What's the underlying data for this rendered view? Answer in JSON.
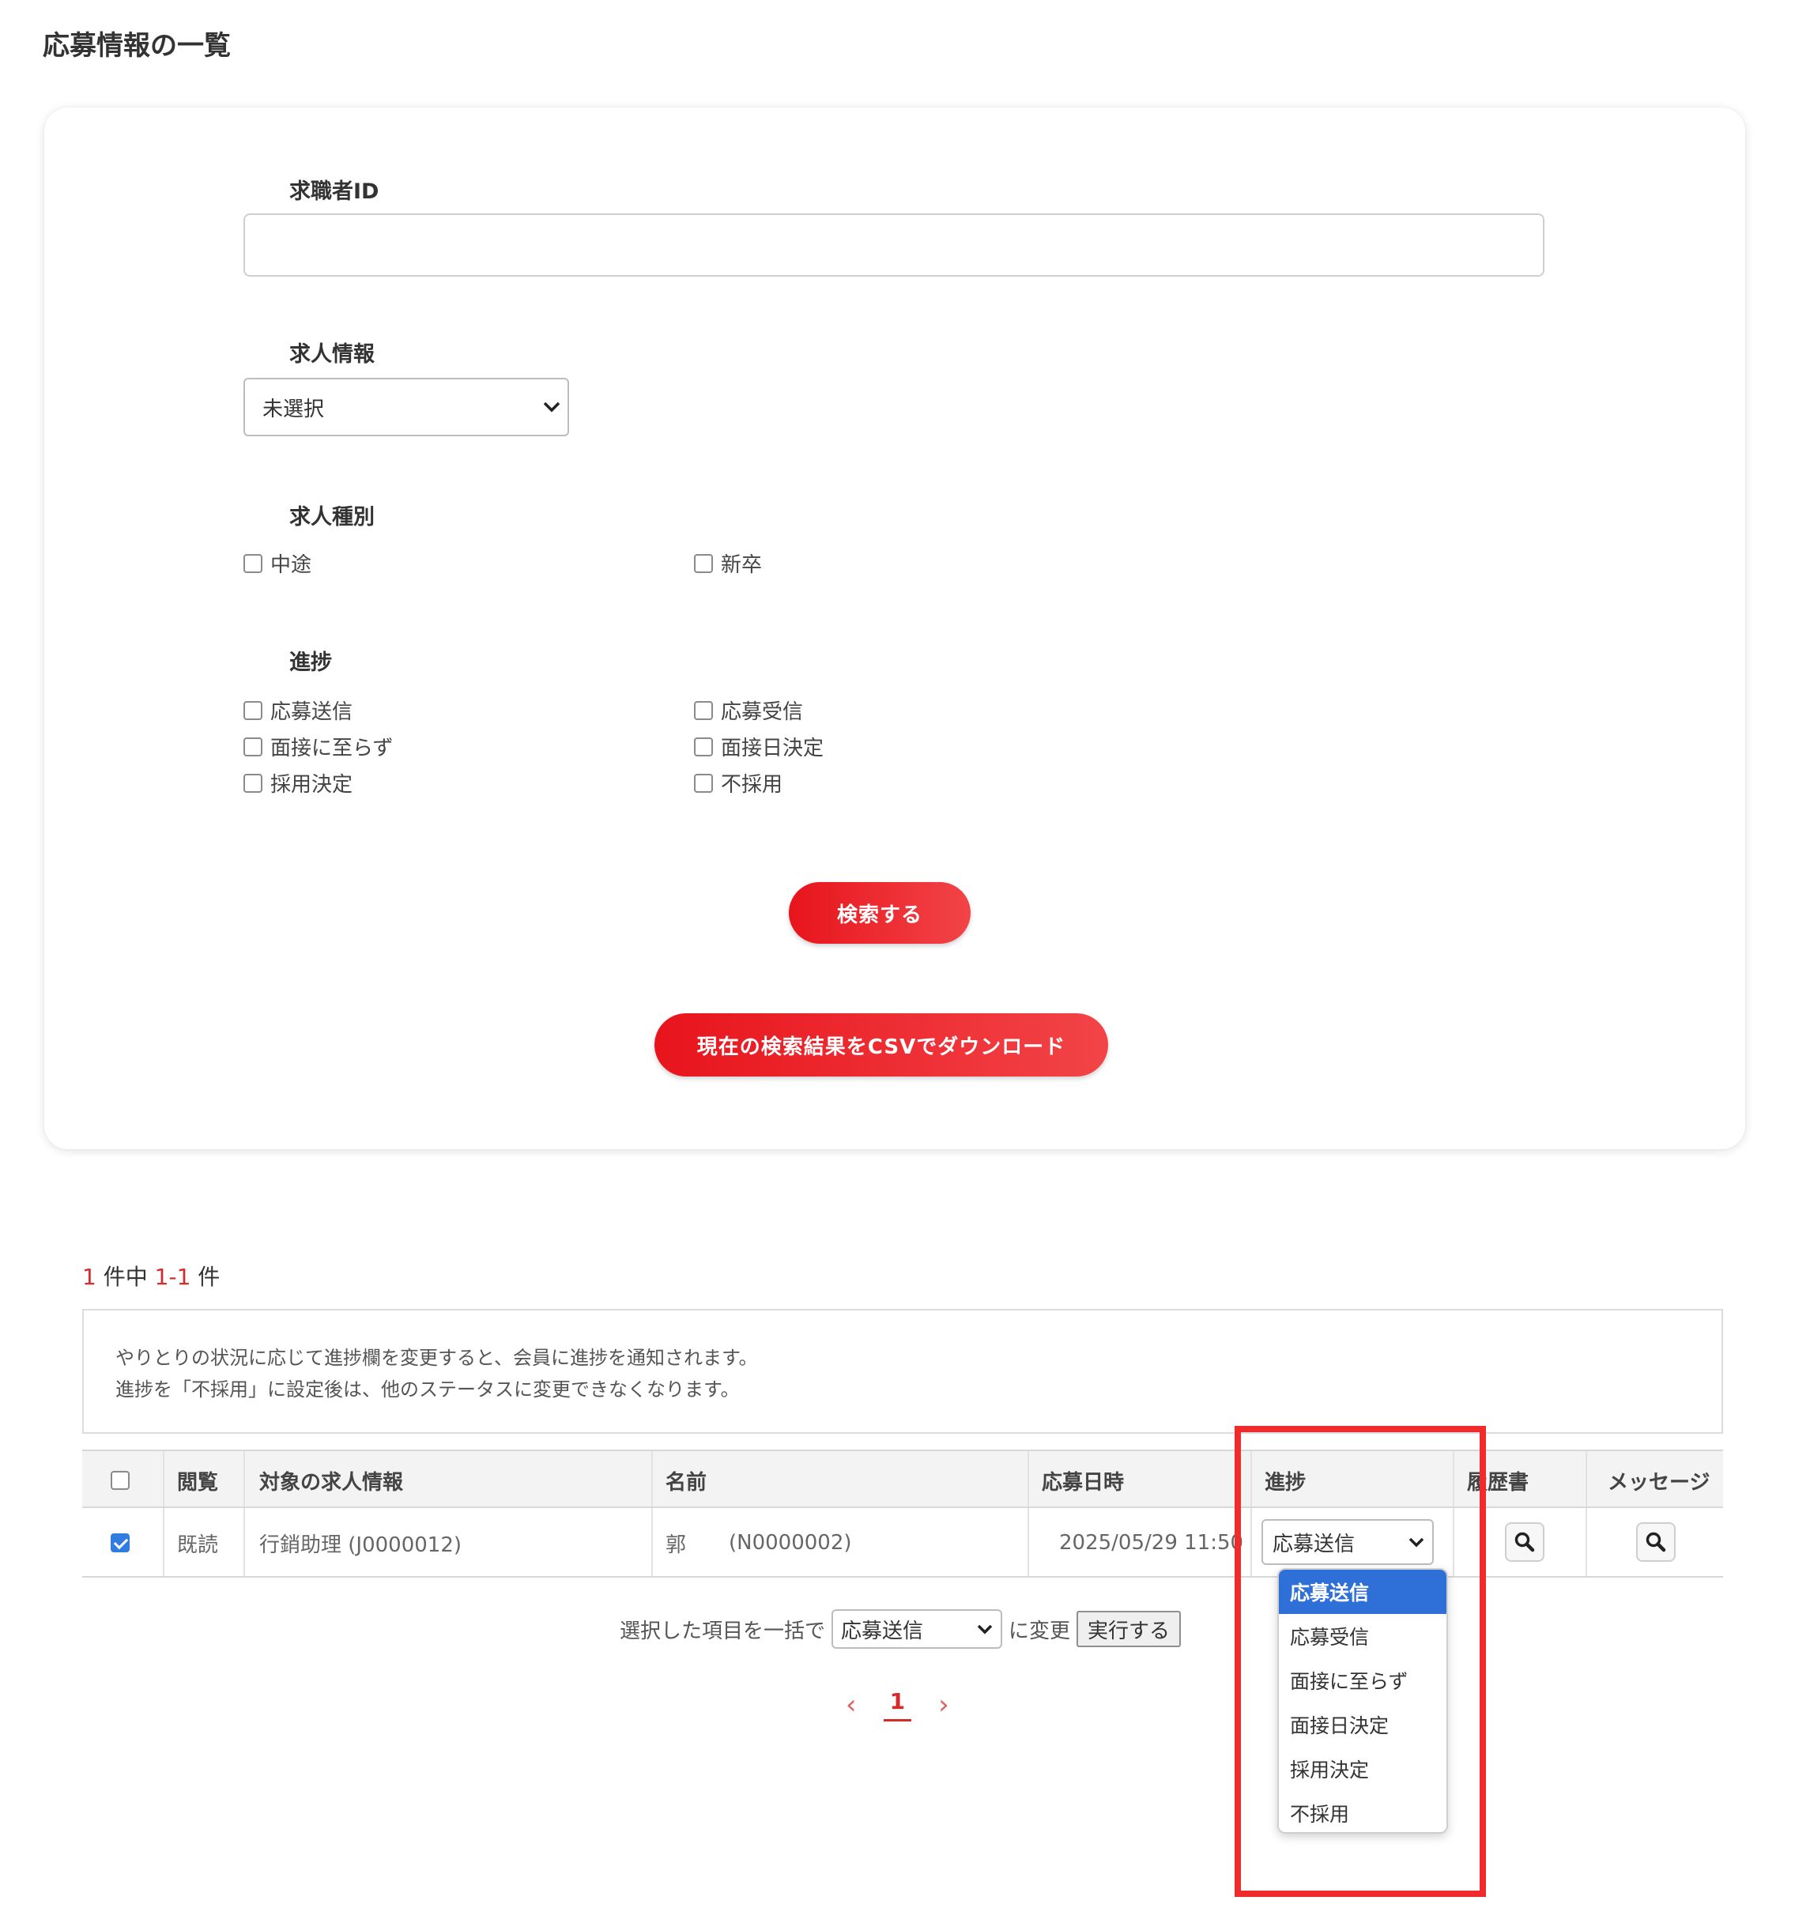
{
  "page": {
    "title": "応募情報の一覧"
  },
  "search": {
    "seeker_id_label": "求職者ID",
    "seeker_id_value": "",
    "job_info_label": "求人情報",
    "job_info_selected": "未選択",
    "job_type_label": "求人種別",
    "job_types": [
      {
        "label": "中途",
        "checked": false
      },
      {
        "label": "新卒",
        "checked": false
      }
    ],
    "progress_label": "進捗",
    "progress_options": [
      {
        "label": "応募送信",
        "checked": false
      },
      {
        "label": "応募受信",
        "checked": false
      },
      {
        "label": "面接に至らず",
        "checked": false
      },
      {
        "label": "面接日決定",
        "checked": false
      },
      {
        "label": "採用決定",
        "checked": false
      },
      {
        "label": "不採用",
        "checked": false
      }
    ],
    "search_button": "検索する",
    "csv_button": "現在の検索結果をCSVでダウンロード"
  },
  "results": {
    "total": "1",
    "total_suffix": "件中",
    "range": "1-1",
    "range_suffix": "件"
  },
  "notice": {
    "line1": "やりとりの状況に応じて進捗欄を変更すると、会員に進捗を通知されます。",
    "line2": "進捗を「不採用」に設定後は、他のステータスに変更できなくなります。"
  },
  "table": {
    "headers": {
      "view": "閲覧",
      "job": "対象の求人情報",
      "name": "名前",
      "date": "応募日時",
      "progress": "進捗",
      "resume": "履歴書",
      "message": "メッセージ"
    },
    "rows": [
      {
        "checked": true,
        "view": "既読",
        "job": "行銷助理 (J0000012)",
        "name": "郭",
        "member_id": "(N0000002)",
        "date": "2025/05/29 11:50",
        "progress": "応募送信"
      }
    ]
  },
  "bulk": {
    "prefix": "選択した項目を一括で",
    "selected": "応募送信",
    "suffix": "に変更",
    "execute_button": "実行する"
  },
  "pager": {
    "current": "1",
    "prev": "‹",
    "next": "›"
  },
  "progress_dropdown": {
    "options": [
      "応募送信",
      "応募受信",
      "面接に至らず",
      "面接日決定",
      "採用決定",
      "不採用"
    ],
    "active_index": 0
  },
  "colors": {
    "accent_red": "#e8141c",
    "highlight_red": "#ef2b2b",
    "select_blue": "#2f6fd8"
  }
}
